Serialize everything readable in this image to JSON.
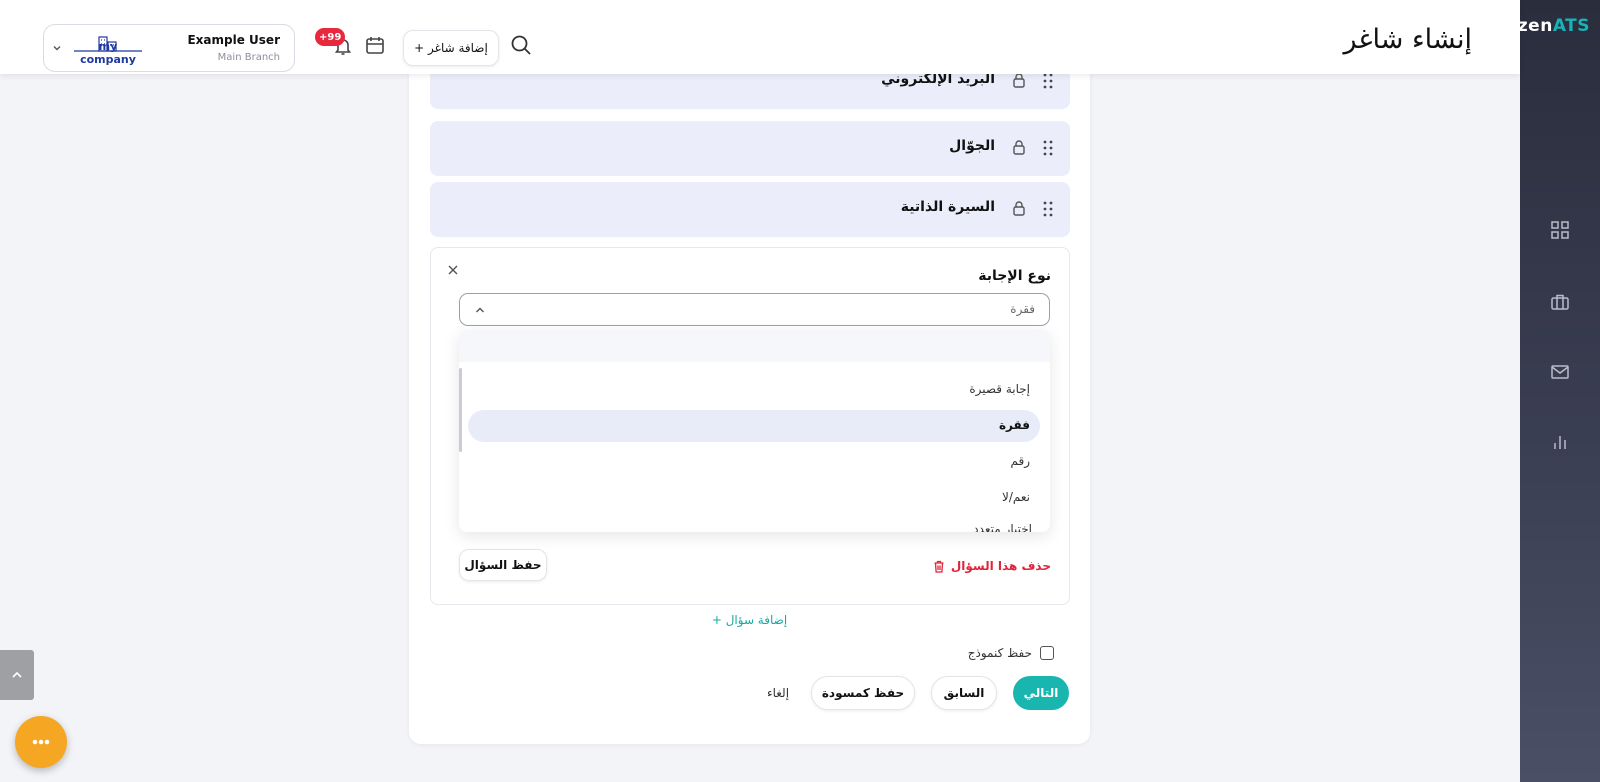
{
  "app": {
    "logo_main": "zen",
    "logo_accent": "ATS"
  },
  "header": {
    "title": "إنشاء شاغر",
    "add_job_label": "+ إضافة شاغر",
    "notif_badge": "+99",
    "user_name": "Example User",
    "user_branch": "Main Branch",
    "company_name": "my company"
  },
  "fields": [
    {
      "label": "البريد الإلكتروني"
    },
    {
      "label": "الجوّال"
    },
    {
      "label": "السيرة الذاتية"
    }
  ],
  "question": {
    "title": "نوع الإجابة",
    "selected_value": "فقرة",
    "options": [
      "إجابة قصيرة",
      "فقرة",
      "رقم",
      "نعم/لا",
      "اختيار متعدد"
    ],
    "delete_label": "حذف هذا السؤال",
    "save_label": "حفظ السؤال"
  },
  "add_question_label": "+ إضافة سؤال",
  "save_template_label": "حفظ كنموذج",
  "actions": {
    "next": "التالي",
    "previous": "السابق",
    "save_draft": "حفظ كمسودة",
    "cancel": "إلغاء"
  },
  "colors": {
    "accent": "#19b6b0",
    "danger": "#e0243a",
    "fab": "#f5a623",
    "sidebar": "#2a2d3c"
  }
}
